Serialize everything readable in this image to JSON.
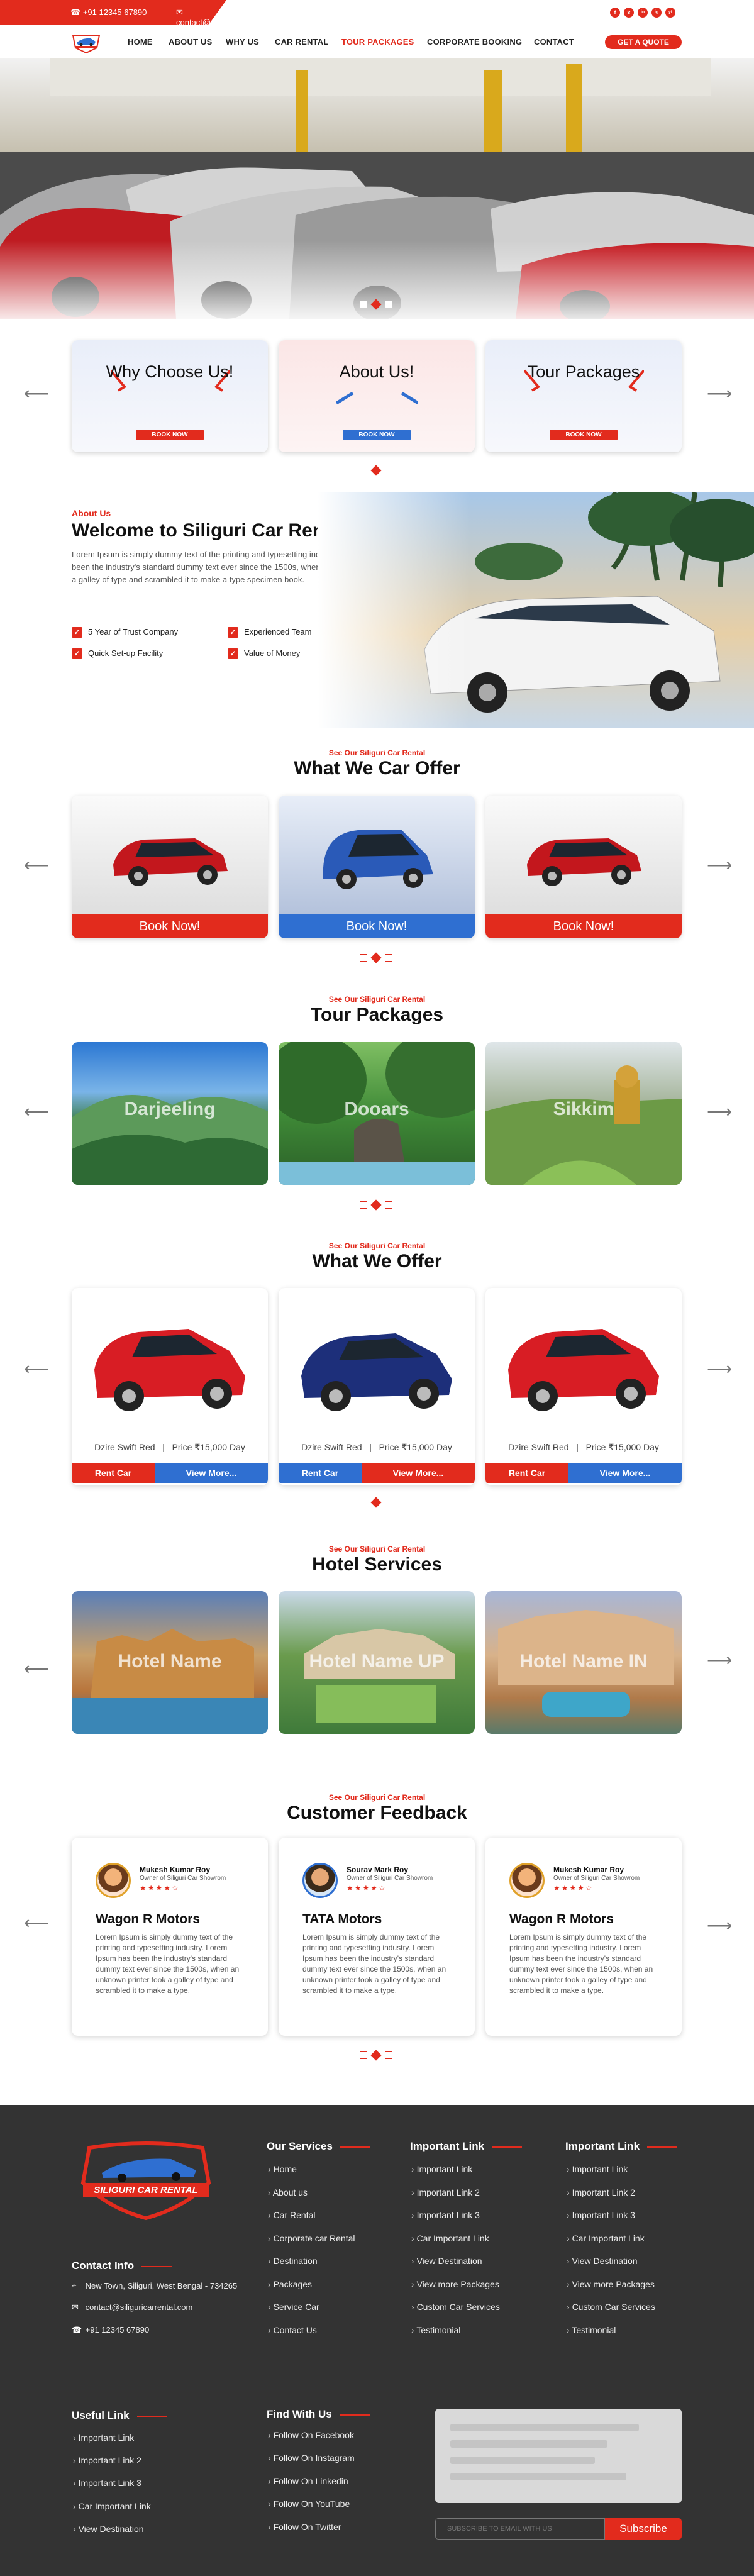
{
  "topbar": {
    "phone": "+91 12345 67890",
    "email": "contact@siliguricarrental.com",
    "social": [
      "f",
      "x",
      "in",
      "ig",
      "yt"
    ]
  },
  "nav": {
    "logo_alt": "Siliguri Car Rental logo",
    "items": [
      "HOME",
      "ABOUT US",
      "WHY US",
      "CAR RENTAL",
      "TOUR PACKAGES",
      "CORPORATE BOOKING",
      "CONTACT"
    ],
    "active": "TOUR PACKAGES",
    "quote": "GET A QUOTE"
  },
  "categories": [
    {
      "title": "Why Choose Us!",
      "button": "BOOK NOW",
      "button_color": "red"
    },
    {
      "title": "About Us!",
      "button": "BOOK NOW",
      "button_color": "blue"
    },
    {
      "title": "Tour Packages",
      "button": "BOOK NOW",
      "button_color": "red"
    }
  ],
  "about": {
    "kicker": "About Us",
    "title": "Welcome to Siliguri Car Rental",
    "text": "Lorem Ipsum is simply dummy text of the printing and typesetting industry. Lorem Ipsum has been the industry's standard dummy text ever since the 1500s, when an unknown printer took a galley of type and scrambled it to make a type specimen book.",
    "features": [
      "5 Year of Trust Company",
      "Experienced Team",
      "Quick Set-up Facility",
      "Value of Money"
    ]
  },
  "car_offer": {
    "kicker": "See Our Siliguri Car Rental",
    "title": "What We Car Offer",
    "cards": [
      {
        "button": "Book Now!",
        "color": "red",
        "car_color": "#c3171d"
      },
      {
        "button": "Book Now!",
        "color": "blue",
        "car_color": "#2a5ab8"
      },
      {
        "button": "Book Now!",
        "color": "red",
        "car_color": "#c3171d"
      }
    ]
  },
  "tours": {
    "kicker": "See Our Siliguri Car Rental",
    "title": "Tour Packages",
    "items": [
      "Darjeeling",
      "Dooars",
      "Sikkim"
    ]
  },
  "offer": {
    "kicker": "See Our Siliguri Car Rental",
    "title": "What We Offer",
    "cards": [
      {
        "model": "Dzire Swift Red",
        "price": "Price ₹15,000 Day",
        "rent": "Rent Car",
        "more": "View More...",
        "car_color": "#d81d24",
        "rent_color": "#e22b1d",
        "more_color": "#2f6fd1"
      },
      {
        "model": "Dzire Swift Red",
        "price": "Price ₹15,000 Day",
        "rent": "Rent Car",
        "more": "View More...",
        "car_color": "#1d2f7a",
        "rent_color": "#2f6fd1",
        "more_color": "#e22b1d"
      },
      {
        "model": "Dzire Swift Red",
        "price": "Price ₹15,000 Day",
        "rent": "Rent Car",
        "more": "View More...",
        "car_color": "#d81d24",
        "rent_color": "#e22b1d",
        "more_color": "#2f6fd1"
      }
    ]
  },
  "hotels": {
    "kicker": "See Our Siliguri Car Rental",
    "title": "Hotel Services",
    "items": [
      "Hotel Name",
      "Hotel Name UP",
      "Hotel Name IN"
    ]
  },
  "feedback": {
    "kicker": "See Our Siliguri Car Rental",
    "title": "Customer Feedback",
    "items": [
      {
        "name": "Mukesh Kumar Roy",
        "role": "Owner of Siliguri Car Showrom",
        "rating": "★★★★☆",
        "car": "Wagon R Motors",
        "text": "Lorem Ipsum is simply dummy text of the printing and typesetting industry. Lorem Ipsum has been the industry's standard dummy text ever since the 1500s, when an unknown printer took a galley of type and scrambled it to make a type."
      },
      {
        "name": "Sourav Mark Roy",
        "role": "Owner of Siliguri Car Showrom",
        "rating": "★★★★☆",
        "car": "TATA Motors",
        "text": "Lorem Ipsum is simply dummy text of the printing and typesetting industry. Lorem Ipsum has been the industry's standard dummy text ever since the 1500s, when an unknown printer took a galley of type and scrambled it to make a type."
      },
      {
        "name": "Mukesh Kumar Roy",
        "role": "Owner of Siliguri Car Showrom",
        "rating": "★★★★☆",
        "car": "Wagon R Motors",
        "text": "Lorem Ipsum is simply dummy text of the printing and typesetting industry. Lorem Ipsum has been the industry's standard dummy text ever since the 1500s, when an unknown printer took a galley of type and scrambled it to make a type."
      }
    ]
  },
  "footer": {
    "logo_text": "SILIGURI CAR RENTAL",
    "services_title": "Our Services",
    "services": [
      "Home",
      "About us",
      "Car Rental",
      "Corporate car Rental",
      "Destination",
      "Packages",
      "Service Car",
      "Contact Us"
    ],
    "important_title": "Important Link",
    "important": [
      "Important Link",
      "Important Link 2",
      "Important Link 3",
      "Car Important Link",
      "View Destination",
      "View more Packages",
      "Custom Car Services",
      "Testimonial"
    ],
    "important2_title": "Important Link",
    "important2": [
      "Important Link",
      "Important Link 2",
      "Important Link 3",
      "Car Important Link",
      "View Destination",
      "View more Packages",
      "Custom Car Services",
      "Testimonial"
    ],
    "contact_title": "Contact Info",
    "address": "New Town, Siliguri, West Bengal - 734265",
    "email": "contact@siliguricarrental.com",
    "phone": "+91 12345 67890",
    "useful_title": "Useful Link",
    "useful": [
      "Important Link",
      "Important Link 2",
      "Important Link 3",
      "Car Important Link",
      "View Destination"
    ],
    "find_title": "Find With Us",
    "find": [
      "Follow On Facebook",
      "Follow On Instagram",
      "Follow On Linkedin",
      "Follow On YouTube",
      "Follow On Twitter"
    ],
    "subscribe_placeholder": "SUBSCRIBE TO EMAIL WITH US",
    "subscribe_button": "Subscribe"
  },
  "colors": {
    "accent": "#e22b1d",
    "blue": "#2f6fd1",
    "footer": "#333333"
  }
}
